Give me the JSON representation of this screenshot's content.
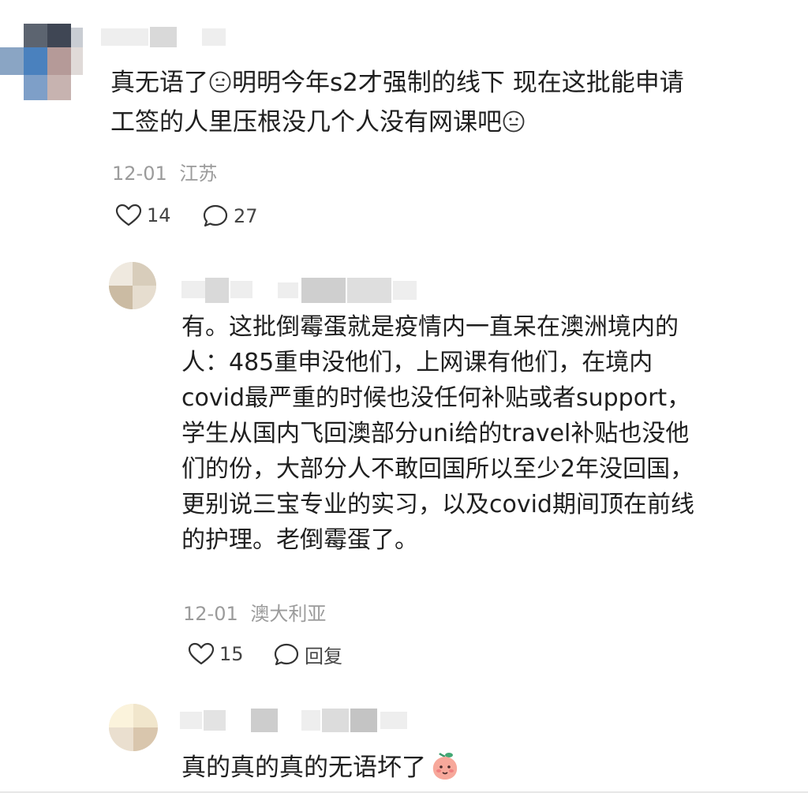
{
  "comments": [
    {
      "lines": [
        "真无语了",
        "明明今年s2才强制的线下 现在这批能申请",
        "工签的人里压根没几个人没有网课吧"
      ],
      "date": "12-01",
      "location": "江苏",
      "likes": "14",
      "replies": "27"
    },
    {
      "lines": [
        "有。这批倒霉蛋就是疫情内一直呆在澳洲境内的",
        "人：485重申没他们，上网课有他们，在境内",
        "covid最严重的时候也没任何补贴或者support，",
        "学生从国内飞回澳部分uni给的travel补贴也没他",
        "们的份，大部分人不敢回国所以至少2年没回国，",
        "更别说三宝专业的实习，以及covid期间顶在前线",
        "的护理。老倒霉蛋了。"
      ],
      "date": "12-01",
      "location": "澳大利亚",
      "likes": "15",
      "reply_label": "回复"
    },
    {
      "lines": [
        "真的真的真的无语坏了"
      ]
    }
  ]
}
